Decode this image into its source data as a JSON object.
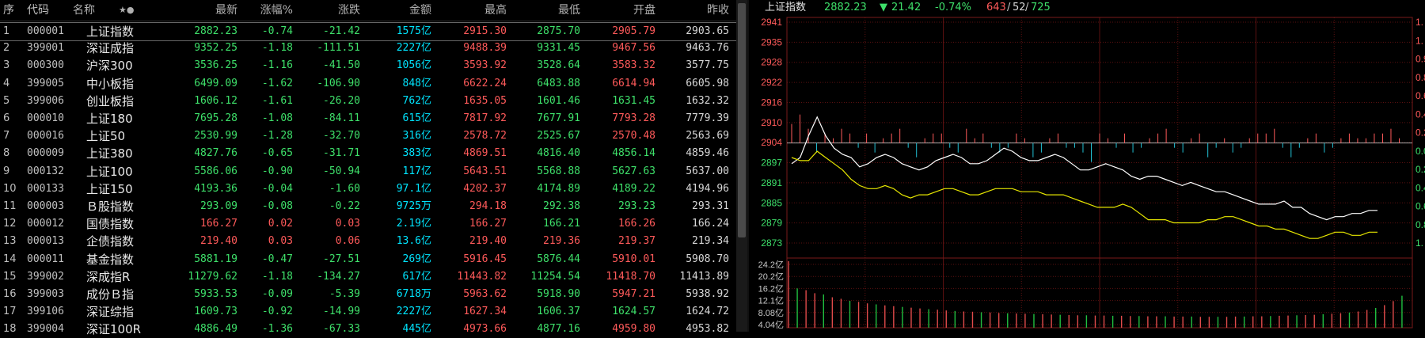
{
  "table": {
    "headers": {
      "seq": "序",
      "code": "代码",
      "name": "名称",
      "sort": "★●",
      "last": "最新",
      "pct": "涨幅%",
      "chg": "涨跌",
      "amt": "金额",
      "high": "最高",
      "low": "最低",
      "open": "开盘",
      "prev": "昨收"
    },
    "rows": [
      {
        "seq": "1",
        "code": "000001",
        "name": "上证指数",
        "last": "2882.23",
        "pct": "-0.74",
        "chg": "-21.42",
        "amt": "1575亿",
        "high": "2915.30",
        "low": "2875.70",
        "open": "2905.79",
        "prev": "2903.65"
      },
      {
        "seq": "2",
        "code": "399001",
        "name": "深证成指",
        "last": "9352.25",
        "pct": "-1.18",
        "chg": "-111.51",
        "amt": "2227亿",
        "high": "9488.39",
        "low": "9331.45",
        "open": "9467.56",
        "prev": "9463.76"
      },
      {
        "seq": "3",
        "code": "000300",
        "name": "沪深300",
        "last": "3536.25",
        "pct": "-1.16",
        "chg": "-41.50",
        "amt": "1056亿",
        "high": "3593.92",
        "low": "3528.64",
        "open": "3583.32",
        "prev": "3577.75"
      },
      {
        "seq": "4",
        "code": "399005",
        "name": "中小板指",
        "last": "6499.09",
        "pct": "-1.62",
        "chg": "-106.90",
        "amt": "848亿",
        "high": "6622.24",
        "low": "6483.88",
        "open": "6614.94",
        "prev": "6605.98"
      },
      {
        "seq": "5",
        "code": "399006",
        "name": "创业板指",
        "last": "1606.12",
        "pct": "-1.61",
        "chg": "-26.20",
        "amt": "762亿",
        "high": "1635.05",
        "low": "1601.46",
        "open": "1631.45",
        "prev": "1632.32"
      },
      {
        "seq": "6",
        "code": "000010",
        "name": "上证180",
        "last": "7695.28",
        "pct": "-1.08",
        "chg": "-84.11",
        "amt": "615亿",
        "high": "7817.92",
        "low": "7677.91",
        "open": "7793.28",
        "prev": "7779.39"
      },
      {
        "seq": "7",
        "code": "000016",
        "name": "上证50",
        "last": "2530.99",
        "pct": "-1.28",
        "chg": "-32.70",
        "amt": "316亿",
        "high": "2578.72",
        "low": "2525.67",
        "open": "2570.48",
        "prev": "2563.69"
      },
      {
        "seq": "8",
        "code": "000009",
        "name": "上证380",
        "last": "4827.76",
        "pct": "-0.65",
        "chg": "-31.71",
        "amt": "383亿",
        "high": "4869.51",
        "low": "4816.40",
        "open": "4856.14",
        "prev": "4859.46"
      },
      {
        "seq": "9",
        "code": "000132",
        "name": "上证100",
        "last": "5586.06",
        "pct": "-0.90",
        "chg": "-50.94",
        "amt": "117亿",
        "high": "5643.51",
        "low": "5568.88",
        "open": "5627.63",
        "prev": "5637.00"
      },
      {
        "seq": "10",
        "code": "000133",
        "name": "上证150",
        "last": "4193.36",
        "pct": "-0.04",
        "chg": "-1.60",
        "amt": "97.1亿",
        "high": "4202.37",
        "low": "4174.89",
        "open": "4189.22",
        "prev": "4194.96"
      },
      {
        "seq": "11",
        "code": "000003",
        "name": "Ｂ股指数",
        "last": "293.09",
        "pct": "-0.08",
        "chg": "-0.22",
        "amt": "9725万",
        "high": "294.18",
        "low": "292.38",
        "open": "293.23",
        "prev": "293.31"
      },
      {
        "seq": "12",
        "code": "000012",
        "name": "国债指数",
        "last": "166.27",
        "pct": "0.02",
        "chg": "0.03",
        "amt": "2.19亿",
        "high": "166.27",
        "low": "166.21",
        "open": "166.26",
        "prev": "166.24"
      },
      {
        "seq": "13",
        "code": "000013",
        "name": "企债指数",
        "last": "219.40",
        "pct": "0.03",
        "chg": "0.06",
        "amt": "13.6亿",
        "high": "219.40",
        "low": "219.36",
        "open": "219.37",
        "prev": "219.34"
      },
      {
        "seq": "14",
        "code": "000011",
        "name": "基金指数",
        "last": "5881.19",
        "pct": "-0.47",
        "chg": "-27.51",
        "amt": "269亿",
        "high": "5916.45",
        "low": "5876.44",
        "open": "5910.01",
        "prev": "5908.70"
      },
      {
        "seq": "15",
        "code": "399002",
        "name": "深成指R",
        "last": "11279.62",
        "pct": "-1.18",
        "chg": "-134.27",
        "amt": "617亿",
        "high": "11443.82",
        "low": "11254.54",
        "open": "11418.70",
        "prev": "11413.89"
      },
      {
        "seq": "16",
        "code": "399003",
        "name": "成份Ｂ指",
        "last": "5933.53",
        "pct": "-0.09",
        "chg": "-5.39",
        "amt": "6718万",
        "high": "5963.62",
        "low": "5918.90",
        "open": "5947.21",
        "prev": "5938.92"
      },
      {
        "seq": "17",
        "code": "399106",
        "name": "深证综指",
        "last": "1609.73",
        "pct": "-0.92",
        "chg": "-14.99",
        "amt": "2227亿",
        "high": "1627.34",
        "low": "1606.37",
        "open": "1624.57",
        "prev": "1624.72"
      },
      {
        "seq": "18",
        "code": "399004",
        "name": "深证100R",
        "last": "4886.49",
        "pct": "-1.36",
        "chg": "-67.33",
        "amt": "445亿",
        "high": "4973.66",
        "low": "4877.16",
        "open": "4959.80",
        "prev": "4953.82"
      }
    ]
  },
  "chart_header": {
    "name": "上证指数",
    "last": "2882.23",
    "arrow": "▼",
    "chg": "21.42",
    "pct": "-0.74%",
    "breadth_up": "643",
    "breadth_flat": "52",
    "breadth_down": "725"
  },
  "colors": {
    "up": "#ff5a5a",
    "down": "#3ee06a",
    "amount": "#00e5ff",
    "price_line": "#ffffff",
    "avg_line": "#e6e600",
    "vol_up": "#e24b4b",
    "vol_down": "#20c040",
    "grid": "#5a1010"
  },
  "chart_data": {
    "type": "line",
    "price_ticks": [
      "2941",
      "2935",
      "2928",
      "2922",
      "2916",
      "2910",
      "2904",
      "2897",
      "2891",
      "2885",
      "2879",
      "2873"
    ],
    "right_pct_ticks": [
      "1.",
      "1.",
      "0.9",
      "0.8",
      "0.6",
      "0.4",
      "0.2",
      "0.0",
      "0.2",
      "0.4",
      "0.6",
      "0.8",
      "1."
    ],
    "volume_ticks": [
      "24.2亿",
      "20.2亿",
      "16.2亿",
      "12.1亿",
      "8.08亿",
      "4.04亿"
    ],
    "prev_close": 2903.65,
    "ylim": [
      2870,
      2944
    ],
    "vol_max": 26.2,
    "series": [
      {
        "values": [
          2897,
          2899,
          2906,
          2912,
          2906,
          2902,
          2900,
          2899,
          2896,
          2897,
          2899,
          2900,
          2899,
          2897,
          2896,
          2895,
          2896,
          2898,
          2899,
          2900,
          2899,
          2897,
          2897,
          2898,
          2900,
          2902,
          2901,
          2899,
          2898,
          2898,
          2899,
          2900,
          2899,
          2897,
          2895,
          2895,
          2896,
          2897,
          2896,
          2895,
          2893,
          2892,
          2893,
          2893,
          2892,
          2891,
          2890,
          2891,
          2890,
          2889,
          2888,
          2888,
          2887,
          2886,
          2885,
          2884,
          2884,
          2884,
          2885,
          2883,
          2883,
          2881,
          2880,
          2879,
          2880,
          2880,
          2881,
          2881,
          2882,
          2882
        ]
      },
      {
        "values": [
          2899,
          2898,
          2898,
          2901,
          2899,
          2897,
          2895,
          2892,
          2890,
          2889,
          2889,
          2890,
          2889,
          2887,
          2886,
          2887,
          2887,
          2888,
          2889,
          2889,
          2888,
          2887,
          2887,
          2888,
          2889,
          2889,
          2889,
          2888,
          2888,
          2888,
          2887,
          2887,
          2887,
          2886,
          2885,
          2884,
          2883,
          2883,
          2883,
          2884,
          2883,
          2881,
          2879,
          2879,
          2879,
          2878,
          2878,
          2878,
          2878,
          2879,
          2879,
          2880,
          2880,
          2879,
          2878,
          2877,
          2877,
          2876,
          2876,
          2875,
          2874,
          2873,
          2873,
          2874,
          2875,
          2875,
          2874,
          2874,
          2875,
          2875
        ]
      }
    ],
    "volume": [
      26.2,
      15.5,
      14.8,
      13.6,
      13.1,
      12.0,
      11.4,
      10.6,
      10.2,
      9.6,
      9.2,
      8.8,
      8.5,
      8.2,
      7.9,
      7.6,
      7.3,
      7.1,
      6.8,
      6.6,
      6.4,
      6.3,
      6.1,
      6.0,
      5.8,
      5.7,
      5.6,
      5.5,
      5.4,
      5.3,
      5.2,
      5.1,
      5.0,
      4.9,
      4.9,
      4.8,
      4.8,
      4.7,
      4.7,
      4.6,
      4.6,
      4.5,
      4.5,
      4.5,
      4.4,
      4.4,
      4.4,
      4.3,
      4.3,
      4.3,
      4.3,
      4.4,
      4.4,
      4.5,
      4.5,
      4.6,
      4.7,
      4.8,
      4.9,
      5.0,
      5.1,
      5.3,
      5.5,
      5.7,
      6.0,
      6.4,
      7.0,
      7.8,
      8.9,
      10.5,
      12.6
    ],
    "diff_bars": [
      4,
      6,
      3,
      -2,
      2,
      1,
      3,
      2,
      -1,
      2,
      -2,
      1,
      2,
      3,
      -1,
      -3,
      1,
      2,
      2,
      -1,
      -2,
      3,
      1,
      2,
      -1,
      -2,
      -1,
      2,
      1,
      -3,
      -2,
      1,
      2,
      -1,
      -1,
      -2,
      -4,
      2,
      1,
      -1,
      2,
      -2,
      -1,
      1,
      2,
      3,
      -1,
      -2,
      1,
      2,
      -3,
      -1,
      1,
      -2,
      -1,
      1,
      2,
      2,
      3,
      -1,
      -3,
      -1,
      1,
      2,
      -2,
      -1,
      1,
      2,
      1,
      1,
      2,
      2,
      3,
      1
    ]
  }
}
